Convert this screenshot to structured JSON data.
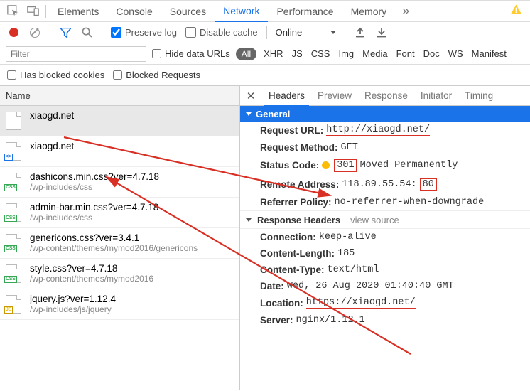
{
  "top": {
    "tabs": [
      "Elements",
      "Console",
      "Sources",
      "Network",
      "Performance",
      "Memory"
    ],
    "active_index": 3,
    "overflow": "»"
  },
  "toolbar": {
    "preserve_log_label": "Preserve log",
    "preserve_log_checked": true,
    "disable_cache_label": "Disable cache",
    "disable_cache_checked": false,
    "throttling": "Online"
  },
  "filter": {
    "placeholder": "Filter",
    "hide_data_urls_label": "Hide data URLs",
    "hide_data_urls_checked": false,
    "types": [
      "All",
      "XHR",
      "JS",
      "CSS",
      "Img",
      "Media",
      "Font",
      "Doc",
      "WS",
      "Manifest"
    ],
    "active_type_index": 0,
    "has_blocked_cookies_label": "Has blocked cookies",
    "blocked_requests_label": "Blocked Requests"
  },
  "requests": {
    "col_header": "Name",
    "selected_index": 0,
    "items": [
      {
        "name": "xiaogd.net",
        "path": "",
        "icon": "doc"
      },
      {
        "name": "xiaogd.net",
        "path": "",
        "icon": "html"
      },
      {
        "name": "dashicons.min.css?ver=4.7.18",
        "path": "/wp-includes/css",
        "icon": "css"
      },
      {
        "name": "admin-bar.min.css?ver=4.7.18",
        "path": "/wp-includes/css",
        "icon": "css"
      },
      {
        "name": "genericons.css?ver=3.4.1",
        "path": "/wp-content/themes/mymod2016/genericons",
        "icon": "css"
      },
      {
        "name": "style.css?ver=4.7.18",
        "path": "/wp-content/themes/mymod2016",
        "icon": "css"
      },
      {
        "name": "jquery.js?ver=1.12.4",
        "path": "/wp-includes/js/jquery",
        "icon": "js"
      }
    ]
  },
  "detail": {
    "tabs": [
      "Headers",
      "Preview",
      "Response",
      "Initiator",
      "Timing"
    ],
    "active_index": 0,
    "general_label": "General",
    "general": {
      "request_url_k": "Request URL:",
      "request_url_v": "http://xiaogd.net/",
      "request_method_k": "Request Method:",
      "request_method_v": "GET",
      "status_code_k": "Status Code:",
      "status_code_num": "301",
      "status_code_text": "Moved Permanently",
      "remote_address_k": "Remote Address:",
      "remote_address_ip": "118.89.55.54:",
      "remote_address_port": "80",
      "referrer_policy_k": "Referrer Policy:",
      "referrer_policy_v": "no-referrer-when-downgrade"
    },
    "response_headers_label": "Response Headers",
    "view_source_label": "view source",
    "response_headers": {
      "connection_k": "Connection:",
      "connection_v": "keep-alive",
      "content_length_k": "Content-Length:",
      "content_length_v": "185",
      "content_type_k": "Content-Type:",
      "content_type_v": "text/html",
      "date_k": "Date:",
      "date_v": "Wed, 26 Aug 2020 01:40:40 GMT",
      "location_k": "Location:",
      "location_v": "https://xiaogd.net/",
      "server_k": "Server:",
      "server_v": "nginx/1.12.1"
    }
  }
}
